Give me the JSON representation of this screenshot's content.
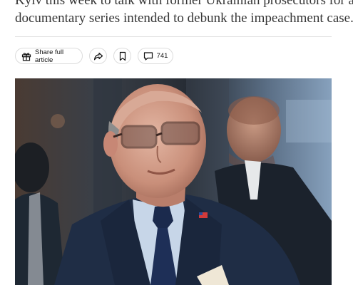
{
  "article": {
    "lead_lines": [
      "Kyiv this week to talk with former Ukrainian prosecutors for a",
      "documentary series intended to debunk the impeachment case."
    ]
  },
  "toolbar": {
    "share_full_label": "Share full article",
    "share_icon": "gift-icon",
    "forward_icon": "share-arrow-icon",
    "bookmark_icon": "bookmark-icon",
    "comment_icon": "comment-icon",
    "comment_count": "741"
  },
  "photo": {
    "subject": "man-in-dark-suit-with-glasses"
  }
}
